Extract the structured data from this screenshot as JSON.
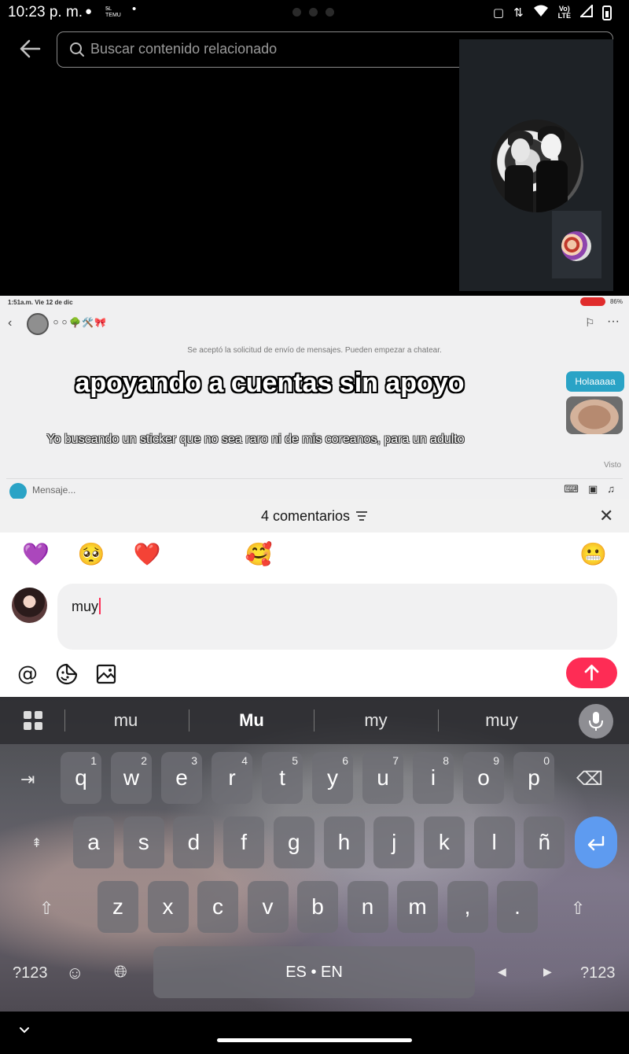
{
  "status_bar": {
    "time": "10:23 p. m.",
    "notif_app_label": "Ѯ.ᎦᏞ\nTEMU"
  },
  "search": {
    "placeholder": "Buscar contenido relacionado"
  },
  "dm_screenshot": {
    "status_time": "1:51a.m.  Vie 12 de dic",
    "battery_text": "86%",
    "notice": "Se aceptó la solicitud de envío de mensajes. Pueden empezar a chatear.",
    "bubble_text": "Holaaaaa",
    "seen_label": "Visto",
    "message_placeholder": "Mensaje..."
  },
  "overlay": {
    "title": "apoyando a cuentas sin apoyo",
    "subtitle": "Yo buscando un sticker que no sea raro ni de mis coreanos, para un adulto"
  },
  "comments": {
    "title": "4 comentarios",
    "emojis": [
      "💜",
      "🥺",
      "❤️",
      "😁",
      "🥰",
      "😂",
      "😳",
      "😏",
      "😅",
      "😌",
      "😬"
    ],
    "input_value": "muy"
  },
  "keyboard": {
    "suggestions": [
      "mu",
      "Mu",
      "my",
      "muy"
    ],
    "row1": [
      [
        "q",
        "1"
      ],
      [
        "w",
        "2"
      ],
      [
        "e",
        "3"
      ],
      [
        "r",
        "4"
      ],
      [
        "t",
        "5"
      ],
      [
        "y",
        "6"
      ],
      [
        "u",
        "7"
      ],
      [
        "i",
        "8"
      ],
      [
        "o",
        "9"
      ],
      [
        "p",
        "0"
      ]
    ],
    "row2": [
      "a",
      "s",
      "d",
      "f",
      "g",
      "h",
      "j",
      "k",
      "l",
      "ñ"
    ],
    "row3": [
      "z",
      "x",
      "c",
      "v",
      "b",
      "n",
      "m",
      ",",
      "."
    ],
    "symbols_label": "?123",
    "space_label": "ES • EN"
  }
}
